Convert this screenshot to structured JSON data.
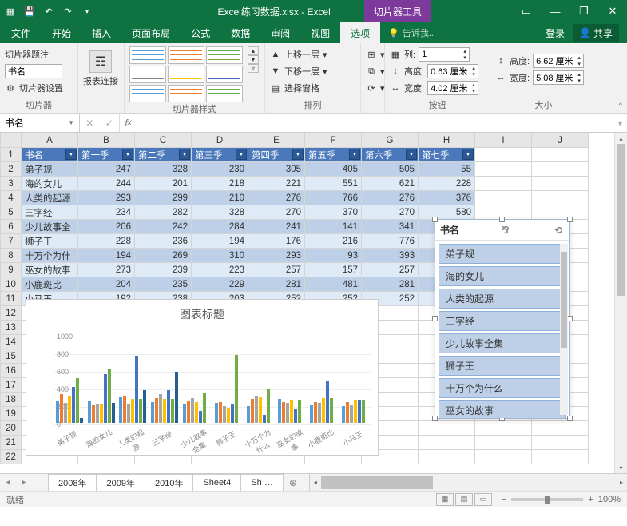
{
  "titlebar": {
    "filename": "Excel练习数据.xlsx - Excel",
    "context_tab": "切片器工具"
  },
  "tabs": {
    "file": "文件",
    "home": "开始",
    "insert": "插入",
    "layout": "页面布局",
    "formulas": "公式",
    "data": "数据",
    "review": "审阅",
    "view": "视图",
    "options": "选项",
    "tell": "告诉我...",
    "login": "登录",
    "share": "共享"
  },
  "ribbon": {
    "group_slicer": "切片器",
    "caption_label": "切片器题注:",
    "caption_value": "书名",
    "settings": "切片器设置",
    "report_conn": "报表连接",
    "group_styles": "切片器样式",
    "group_arrange": "排列",
    "bring_fwd": "上移一层",
    "send_back": "下移一层",
    "select_pane": "选择窗格",
    "align": "",
    "group": "",
    "rotate": "",
    "group_buttons": "按钮",
    "columns": "列:",
    "columns_val": "1",
    "height": "高度:",
    "height_val": "0.63 厘米",
    "width": "宽度:",
    "width_val": "4.02 厘米",
    "group_size": "大小",
    "s_height": "高度:",
    "s_height_val": "6.62 厘米",
    "s_width": "宽度:",
    "s_width_val": "5.08 厘米"
  },
  "namebox": "书名",
  "table": {
    "cols": [
      "A",
      "B",
      "C",
      "D",
      "E",
      "F",
      "G",
      "H",
      "I",
      "J"
    ],
    "headers": [
      "书名",
      "第一季",
      "第二季",
      "第三季",
      "第四季",
      "第五季",
      "第六季",
      "第七季"
    ],
    "rows": [
      [
        "弟子规",
        247,
        328,
        230,
        305,
        405,
        505,
        55
      ],
      [
        "海的女儿",
        244,
        201,
        218,
        221,
        551,
        621,
        228
      ],
      [
        "人类的起源",
        293,
        299,
        210,
        276,
        766,
        276,
        376
      ],
      [
        "三字经",
        234,
        282,
        328,
        270,
        370,
        270,
        580
      ],
      [
        "少儿故事全",
        206,
        242,
        284,
        241,
        141,
        341,
        ""
      ],
      [
        "狮子王",
        228,
        236,
        194,
        176,
        216,
        776,
        ""
      ],
      [
        "十万个为什",
        194,
        269,
        310,
        293,
        93,
        393,
        ""
      ],
      [
        "巫女的故事",
        273,
        239,
        223,
        257,
        157,
        257,
        ""
      ],
      [
        "小鹿斑比",
        204,
        235,
        229,
        281,
        481,
        281,
        ""
      ],
      [
        "小马王",
        192,
        238,
        203,
        252,
        252,
        252,
        ""
      ]
    ]
  },
  "chart_data": {
    "type": "bar",
    "title": "图表标题",
    "categories": [
      "弟子规",
      "海的女儿",
      "人类的起源",
      "三字经",
      "少儿故事全集",
      "狮子王",
      "十万个为什么",
      "巫女的故事",
      "小鹿斑比",
      "小马王"
    ],
    "series": [
      {
        "name": "第一季",
        "color": "#5b9bd5",
        "values": [
          247,
          244,
          293,
          234,
          206,
          228,
          194,
          273,
          204,
          192
        ]
      },
      {
        "name": "第二季",
        "color": "#ed7d31",
        "values": [
          328,
          201,
          299,
          282,
          242,
          236,
          269,
          239,
          235,
          238
        ]
      },
      {
        "name": "第三季",
        "color": "#a5a5a5",
        "values": [
          230,
          218,
          210,
          328,
          284,
          194,
          310,
          223,
          229,
          203
        ]
      },
      {
        "name": "第四季",
        "color": "#ffc000",
        "values": [
          305,
          221,
          276,
          270,
          241,
          176,
          293,
          257,
          281,
          252
        ]
      },
      {
        "name": "第五季",
        "color": "#4472c4",
        "values": [
          405,
          551,
          766,
          370,
          141,
          216,
          93,
          157,
          481,
          252
        ]
      },
      {
        "name": "第六季",
        "color": "#70ad47",
        "values": [
          505,
          621,
          276,
          270,
          341,
          776,
          393,
          257,
          281,
          252
        ]
      },
      {
        "name": "第七季",
        "color": "#255e91",
        "values": [
          55,
          228,
          376,
          580,
          0,
          0,
          0,
          0,
          0,
          0
        ]
      }
    ],
    "ylim": [
      0,
      1000
    ],
    "yticks": [
      0,
      200,
      400,
      600,
      800,
      1000
    ]
  },
  "slicer": {
    "title": "书名",
    "items": [
      "弟子规",
      "海的女儿",
      "人类的起源",
      "三字经",
      "少儿故事全集",
      "狮子王",
      "十万个为什么",
      "巫女的故事"
    ]
  },
  "sheets": [
    "2008年",
    "2009年",
    "2010年",
    "Sheet4",
    "Sh …"
  ],
  "status": {
    "ready": "就绪",
    "zoom": "100%"
  }
}
